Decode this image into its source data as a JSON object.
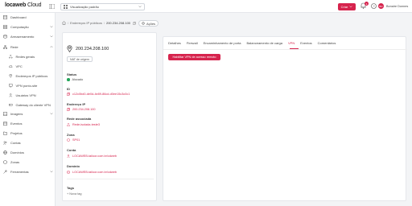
{
  "brand": {
    "logo_main": "locaweb",
    "logo_suffix": " Cloud",
    "accent": "#d6234d"
  },
  "header": {
    "view_select": "Visualização padrão",
    "create_label": "Criar",
    "notifications_count": "3",
    "avatar_initials": "BD",
    "user_name": "Bonaire Donnes"
  },
  "sidebar": {
    "items": [
      {
        "label": "Dashboard",
        "icon": "dashboard-icon"
      },
      {
        "label": "Computação",
        "icon": "server-icon"
      },
      {
        "label": "Armazenamento",
        "icon": "storage-icon"
      },
      {
        "label": "Rede",
        "icon": "network-icon"
      }
    ],
    "network_sub": [
      {
        "label": "Redes gerais",
        "icon": "network-icon"
      },
      {
        "label": "VPC",
        "icon": "cloud-icon"
      },
      {
        "label": "Endereços IP públicos",
        "icon": "location-pin-icon"
      },
      {
        "label": "VPN ponto-site",
        "icon": "monitor-icon"
      },
      {
        "label": "Usuários VPN",
        "icon": "user-icon"
      },
      {
        "label": "Gateway do cliente VPN",
        "icon": "gateway-icon"
      }
    ],
    "lower": [
      {
        "label": "Imagens",
        "icon": "image-icon"
      },
      {
        "label": "Eventos",
        "icon": "calendar-icon"
      },
      {
        "label": "Projetos",
        "icon": "folder-icon"
      },
      {
        "label": "Contas",
        "icon": "users-icon"
      },
      {
        "label": "Domínios",
        "icon": "globe-icon"
      },
      {
        "label": "Zonas",
        "icon": "zone-icon"
      },
      {
        "label": "Ferramentas",
        "icon": "wrench-icon"
      }
    ]
  },
  "breadcrumb": {
    "parent": "Endereços IP públicos",
    "current": "200.234.208.100",
    "actions_label": "Ações"
  },
  "details": {
    "ip": "200.234.208.100",
    "type_badge": "NAT de origem",
    "status_label": "Status",
    "status_value": "Alocado",
    "id_label": "ID",
    "id_value": "c12c0bd0-de0d-4e89-86cd-d0ee15c3c0c1",
    "ip_label": "Endereço IP",
    "ip_value": "200.234.208.100",
    "network_label": "Rede associada",
    "network_value": "Rede-isolada-teste3",
    "zone_label": "Zona",
    "zone_value": "SP01",
    "account_label": "Conta",
    "account_value": "LOCAWEB-tailoor.com.br/cdweb",
    "owner_label": "Domínio",
    "owner_value": "LOCAWEB-tailoor.com.br/cdweb",
    "tags_label": "Tags",
    "add_tag": "+ Nova tag"
  },
  "tabs": {
    "items": [
      "Detalhes",
      "Firewall",
      "Encaminhamento de porta",
      "Balanceamento de carga",
      "VPN",
      "Eventos",
      "Comentários"
    ],
    "active": "VPN",
    "enable_vpn": "Habilitar VPN de acesso remoto"
  }
}
